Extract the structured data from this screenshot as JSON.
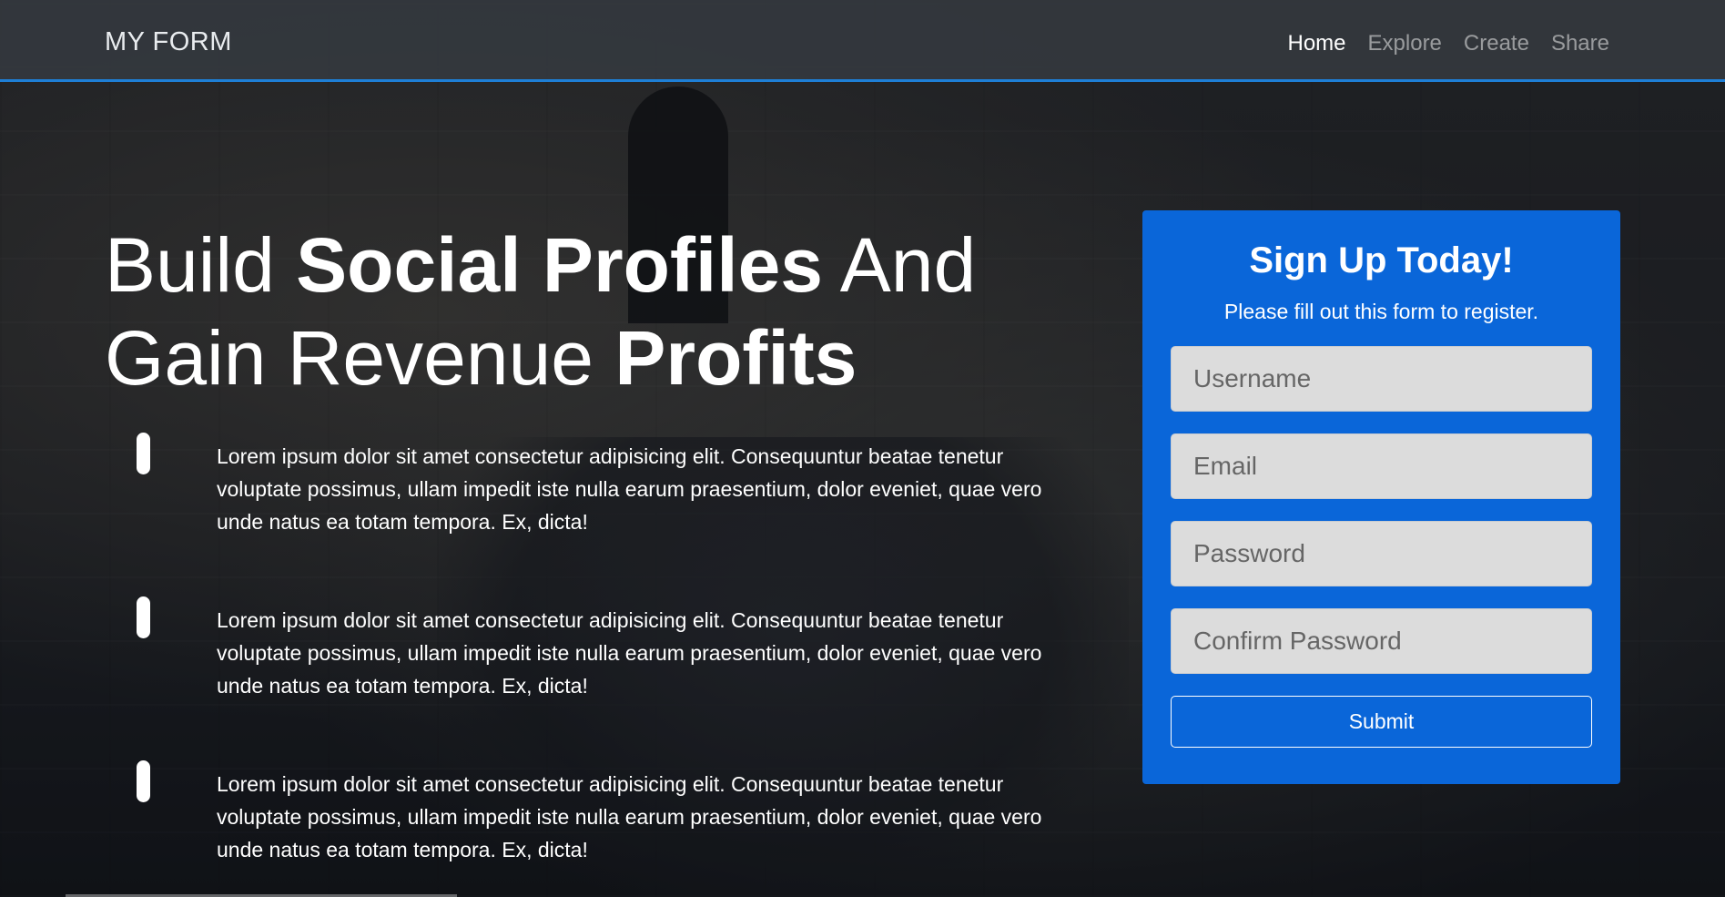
{
  "navbar": {
    "brand": "MY FORM",
    "links": [
      "Home",
      "Explore",
      "Create",
      "Share"
    ],
    "active": "Home"
  },
  "hero": {
    "title_parts": [
      {
        "text": "Build ",
        "bold": false
      },
      {
        "text": "Social Profiles",
        "bold": true
      },
      {
        "text": " And Gain Revenue ",
        "bold": false
      },
      {
        "text": "Profits",
        "bold": true
      }
    ],
    "features": [
      "Lorem ipsum dolor sit amet consectetur adipisicing elit. Consequuntur beatae tenetur voluptate possimus, ullam impedit iste nulla earum praesentium, dolor eveniet, quae vero unde natus ea totam tempora. Ex, dicta!",
      "Lorem ipsum dolor sit amet consectetur adipisicing elit. Consequuntur beatae tenetur voluptate possimus, ullam impedit iste nulla earum praesentium, dolor eveniet, quae vero unde natus ea totam tempora. Ex, dicta!",
      "Lorem ipsum dolor sit amet consectetur adipisicing elit. Consequuntur beatae tenetur voluptate possimus, ullam impedit iste nulla earum praesentium, dolor eveniet, quae vero unde natus ea totam tempora. Ex, dicta!"
    ]
  },
  "signup": {
    "title": "Sign Up Today!",
    "subtitle": "Please fill out this form to register.",
    "username_placeholder": "Username",
    "email_placeholder": "Email",
    "password_placeholder": "Password",
    "confirm_password_placeholder": "Confirm Password",
    "submit_label": "Submit"
  },
  "colors": {
    "accent": "#1e7fd6",
    "card": "#0a66d9"
  }
}
